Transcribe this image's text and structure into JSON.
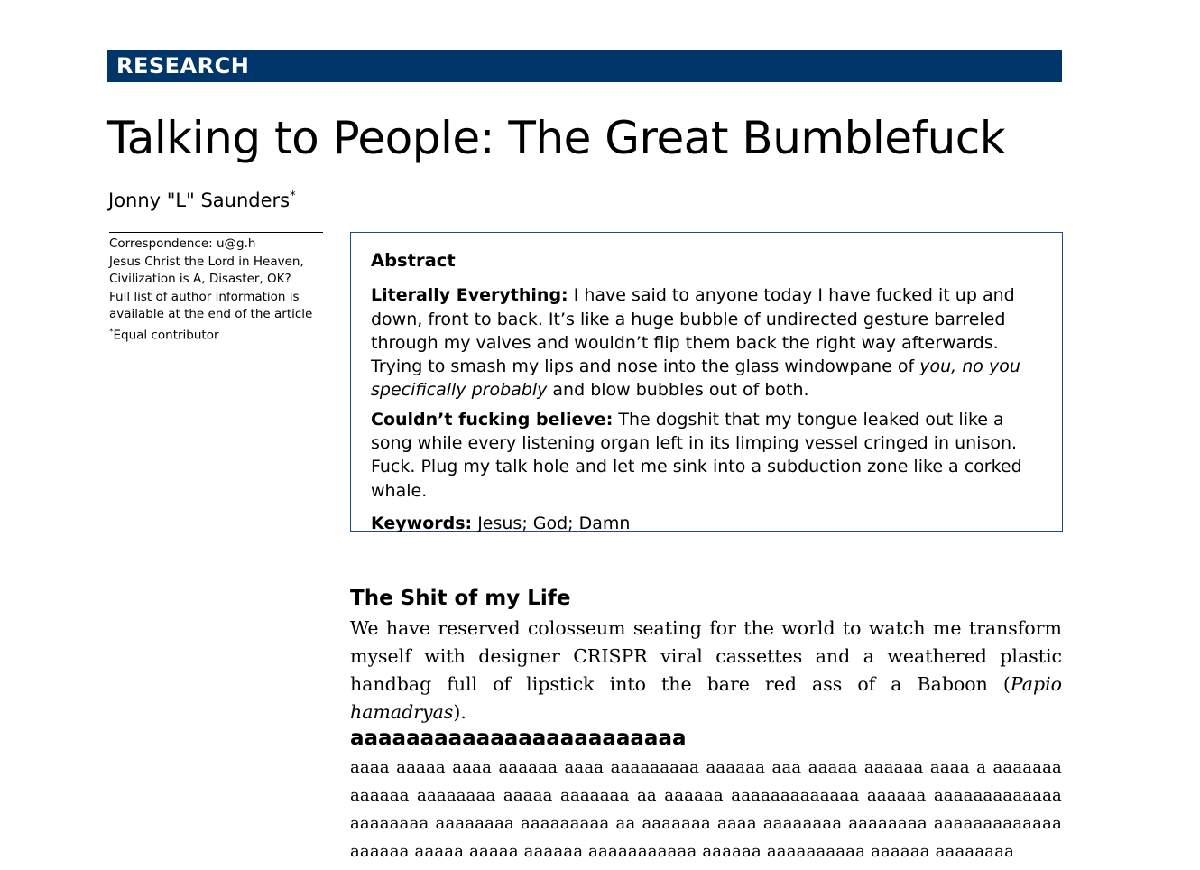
{
  "banner": {
    "label": "RESEARCH"
  },
  "title": "Talking to People: The Great Bumblefuck",
  "author": {
    "name": "Jonny \"L\" Saunders",
    "mark": "*"
  },
  "sidenote": {
    "correspondence": "Correspondence: u@g.h",
    "affiliation_line1": "Jesus Christ the Lord in Heaven,",
    "affiliation_line2": "Civilization is A, Disaster, OK?",
    "fulllist_line1": "Full list of author information is",
    "fulllist_line2": "available at the end of the article",
    "equal_mark": "*",
    "equal_text": "Equal contributor"
  },
  "abstract": {
    "heading": "Abstract",
    "p1_label": "Literally Everything:",
    "p1_text_a": " I have said to anyone today I have fucked it up and down, front to back. It’s like a huge bubble of undirected gesture barreled through my valves and wouldn’t flip them back the right way afterwards. Trying to smash my lips and nose into the glass windowpane of ",
    "p1_italic": "you, no you specifically probably",
    "p1_text_b": " and blow bubbles out of both.",
    "p2_label": "Couldn’t fucking believe:",
    "p2_text": " The dogshit that my tongue leaked out like a song while every listening organ left in its limping vessel cringed in unison. Fuck. Plug my talk hole and let me sink into a subduction zone like a corked whale.",
    "kw_label": "Keywords:",
    "kw_text": " Jesus; God; Damn"
  },
  "section1": {
    "title": "The Shit of my Life",
    "text_a": "We have reserved colosseum seating for the world to watch me transform myself with designer CRISPR viral cassettes and a weathered plastic handbag full of lipstick into the bare red ass of a Baboon (",
    "italic": "Papio hamadryas",
    "text_b": ")."
  },
  "section2": {
    "title": "aaaaaaaaaaaaaaaaaaaaaaaa",
    "text": "aaaa aaaaa aaaa aaaaaa aaaa aaaaaaaaa aaaaaa aaa aaaaa aaaaaa aaaa a aaaaaaa aaaaaa aaaaaaaa aaaaa aaaaaaa aa aaaaaa aaaaaaaaaaaaa aaaaaa aaaaaaaaaaaaa aaaaaaaa aaaaaaaa aaaaaaaaa aa aaaaaaa aaaa aaaaaaaa aaaaaaaa aaaaaaaaaaaaa aaaaaa aaaaa aaaaa aaaaaa aaaaaaaaaaa aaaaaa aaaaaaaaaa aaaaaa aaaaaaaa"
  }
}
